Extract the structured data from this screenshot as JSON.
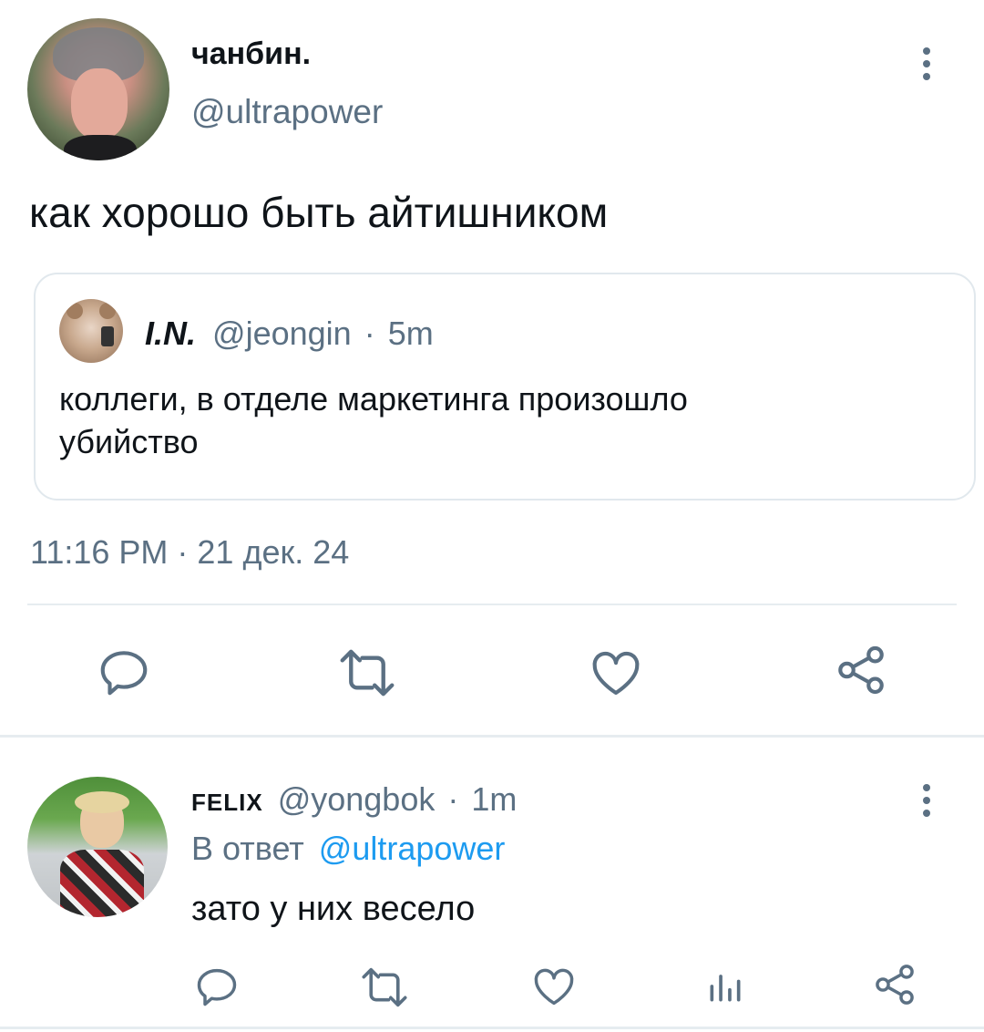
{
  "main_tweet": {
    "display_name": "чанбин.",
    "handle": "@ultrapower",
    "text": "как хорошо быть айтишником",
    "timestamp": "11:16 PM · 21 дек. 24",
    "more_icon": "more-vertical-icon",
    "quote": {
      "display_name": "I.N.",
      "handle": "@jeongin",
      "separator": "·",
      "time": "5m",
      "text_line1": "коллеги, в отделе маркетинга произошло",
      "text_line2": "убийство"
    },
    "actions": [
      "reply-icon",
      "retweet-icon",
      "like-icon",
      "share-icon"
    ]
  },
  "reply_tweet": {
    "display_name": "FELIX",
    "handle": "@yongbok",
    "separator": "·",
    "time": "1m",
    "reply_prefix": "В ответ",
    "reply_to": "@ultrapower",
    "text": "зато у них весело",
    "more_icon": "more-vertical-icon",
    "actions": [
      "reply-icon",
      "retweet-icon",
      "like-icon",
      "analytics-icon",
      "share-icon"
    ]
  },
  "colors": {
    "text": "#0f1419",
    "muted": "#5b7083",
    "link": "#1d9bf0",
    "divider": "#e6ecf0"
  }
}
